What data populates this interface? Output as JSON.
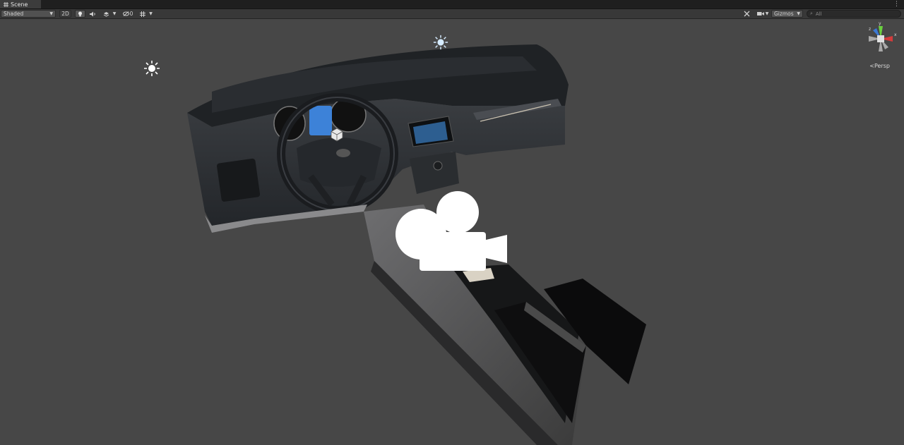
{
  "window": {
    "tab_title": "Scene",
    "tab_icon": "grid-icon",
    "menu_icon": "kebab-menu-icon"
  },
  "toolbar": {
    "shading_mode": "Shaded",
    "mode_2d": "2D",
    "hidden_count": "0",
    "gizmos_label": "Gizmos",
    "search_placeholder": "All"
  },
  "orientation_gizmo": {
    "label": "<Persp",
    "axes": [
      "x",
      "y",
      "z"
    ],
    "colors": {
      "x": "#d33b3b",
      "y": "#6ad13f",
      "z": "#3b78d3"
    }
  },
  "scene": {
    "light_icons": 2,
    "camera_icon": "camera-gizmo-icon",
    "object_icon": "cube-pivot-icon"
  }
}
